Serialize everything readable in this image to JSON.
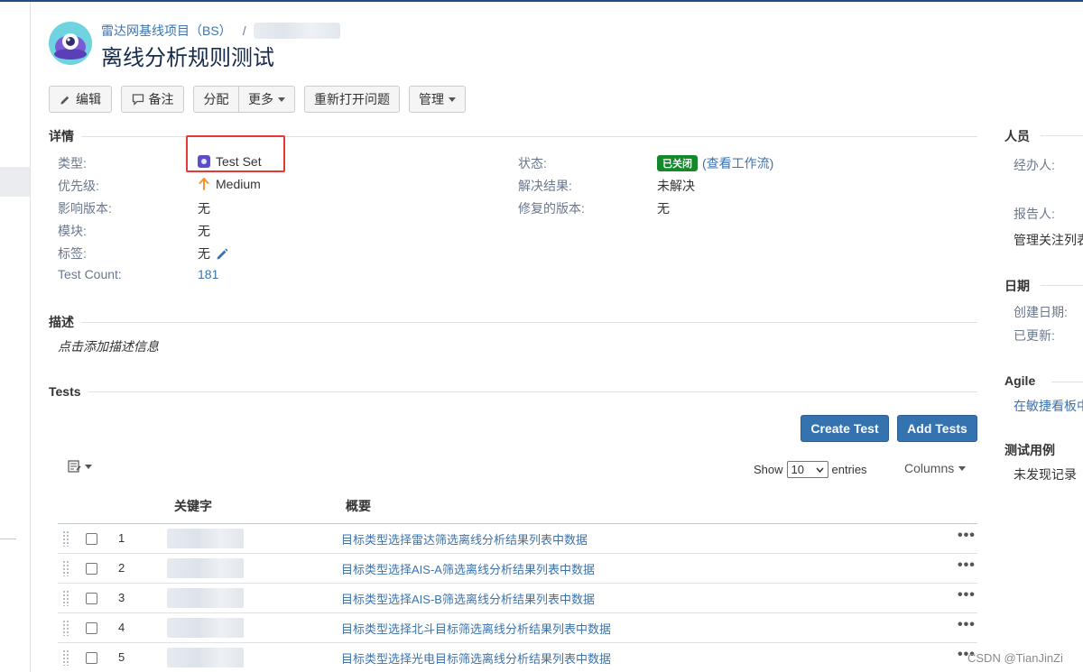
{
  "header": {
    "breadcrumb_project": "雷达网基线项目（BS）",
    "breadcrumb_sep": "/",
    "title": "离线分析规则测试"
  },
  "toolbar": {
    "edit": "编辑",
    "comment": "备注",
    "assign": "分配",
    "more": "更多",
    "reopen": "重新打开问题",
    "admin": "管理"
  },
  "details": {
    "heading": "详情",
    "fields_left": [
      {
        "label": "类型:",
        "value": "Test Set",
        "icon": "test-set-icon"
      },
      {
        "label": "优先级:",
        "value": "Medium",
        "icon": "priority-up-arrow-icon"
      },
      {
        "label": "影响版本:",
        "value": "无"
      },
      {
        "label": "模块:",
        "value": "无"
      },
      {
        "label": "标签:",
        "value": "无",
        "icon": "pencil-icon"
      },
      {
        "label": "Test Count:",
        "value": "181"
      }
    ],
    "fields_right": [
      {
        "label": "状态:",
        "badge": "已关闭",
        "link": "(查看工作流)"
      },
      {
        "label": "解决结果:",
        "value": "未解决"
      },
      {
        "label": "修复的版本:",
        "value": "无"
      }
    ]
  },
  "description": {
    "heading": "描述",
    "placeholder": "点击添加描述信息"
  },
  "tests": {
    "heading": "Tests",
    "create_btn": "Create Test",
    "add_btn": "Add Tests",
    "show_label": "Show",
    "show_value": "10",
    "entries_label": "entries",
    "columns_label": "Columns",
    "columns": [
      "关键字",
      "概要"
    ],
    "rows": [
      {
        "num": "1",
        "summary": "目标类型选择雷达筛选离线分析结果列表中数据"
      },
      {
        "num": "2",
        "summary": "目标类型选择AIS-A筛选离线分析结果列表中数据"
      },
      {
        "num": "3",
        "summary": "目标类型选择AIS-B筛选离线分析结果列表中数据"
      },
      {
        "num": "4",
        "summary": "目标类型选择北斗目标筛选离线分析结果列表中数据"
      },
      {
        "num": "5",
        "summary": "目标类型选择光电目标筛选离线分析结果列表中数据"
      }
    ],
    "row_menu": "•••"
  },
  "sidebar": {
    "people_heading": "人员",
    "assignee_label": "经办人:",
    "reporter_label": "报告人:",
    "watchers_label": "管理关注列表",
    "dates_heading": "日期",
    "created_label": "创建日期:",
    "updated_label": "已更新:",
    "agile_heading": "Agile",
    "agile_link": "在敏捷看板中",
    "testcase_heading": "测试用例",
    "testcase_value": "未发现记录"
  },
  "watermark": "CSDN @TianJinZi",
  "colors": {
    "link": "#3b73af",
    "primary_button": "#3572b0",
    "status_closed": "#14892c",
    "highlight_box": "#e53935"
  }
}
